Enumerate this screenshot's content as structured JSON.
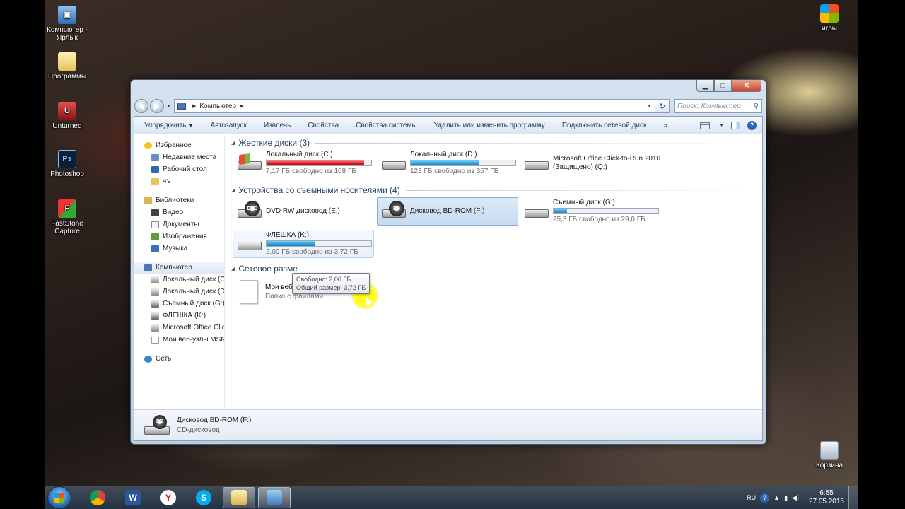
{
  "desktop": {
    "icons": [
      {
        "label": "Компьютер - Ярлык",
        "icon": "computer-shortcut-icon"
      },
      {
        "label": "Программы",
        "icon": "folder-icon"
      },
      {
        "label": "Unturned",
        "icon": "unturned-icon"
      },
      {
        "label": "Photoshop",
        "icon": "photoshop-icon"
      },
      {
        "label": "FastStone Capture",
        "icon": "faststone-icon"
      },
      {
        "label": "игры",
        "icon": "games-icon"
      },
      {
        "label": "Корзина",
        "icon": "recycle-bin-icon"
      }
    ]
  },
  "window": {
    "address": {
      "root": "Компьютер"
    },
    "search_placeholder": "Поиск: Компьютер",
    "toolbar": {
      "organize": "Упорядочить",
      "autoplay": "Автозапуск",
      "eject": "Извлечь",
      "properties": "Свойства",
      "system_properties": "Свойства системы",
      "uninstall": "Удалить или изменить программу",
      "map_drive": "Подключить сетевой диск",
      "more": "»"
    },
    "nav": {
      "favorites": "Избранное",
      "recent": "Недавние места",
      "desktop": "Рабочий стол",
      "ch": "чъ",
      "libraries": "Библиотеки",
      "video": "Видео",
      "documents": "Документы",
      "pictures": "Изображения",
      "music": "Музыка",
      "computer": "Компьютер",
      "drive_c": "Локальный диск (C:",
      "drive_d": "Локальный диск (D",
      "drive_g": "Съемный диск (G:)",
      "drive_k": "ФЛЕШКА (K:)",
      "office": "Microsoft Office Clic",
      "msn": "Мои веб-узлы MSN",
      "network": "Сеть"
    },
    "groups": {
      "hard_drives": "Жесткие диски (3)",
      "removable": "Устройства со съемными носителями (4)",
      "network_locations": "Сетевое разме"
    },
    "drives": {
      "c": {
        "name": "Локальный диск (C:)",
        "free": "7,17 ГБ свободно из 108 ГБ",
        "used_fraction": 0.934
      },
      "d": {
        "name": "Локальный диск (D:)",
        "free": "123 ГБ свободно из 357 ГБ",
        "used_fraction": 0.655
      },
      "q": {
        "name": "Microsoft Office Click-to-Run 2010",
        "sub": "(Защищено) (Q:)"
      },
      "e": {
        "name": "DVD RW дисковод (E:)",
        "disc_label": "DVD"
      },
      "f": {
        "name": "Дисковод BD-ROM (F:)",
        "disc_label": "BD"
      },
      "g": {
        "name": "Съемный диск (G:)",
        "free": "25,3 ГБ свободно из 29,0 ГБ",
        "used_fraction": 0.128
      },
      "k": {
        "name": "ФЛЕШКА (K:)",
        "free": "2,00 ГБ свободно из 3,72 ГБ",
        "used_fraction": 0.462
      }
    },
    "tooltip": {
      "free": "Свободно: 2,00 ГБ",
      "total": "Общий размер: 3,72 ГБ"
    },
    "msn_folder": {
      "name": "Мои веб-узлы MSN",
      "type": "Папка с файлами"
    },
    "details": {
      "name": "Дисковод BD-ROM (F:)",
      "type": "CD-дисковод",
      "disc_label": "BD"
    }
  },
  "taskbar": {
    "apps": [
      "chrome-icon",
      "word-icon",
      "yandex-icon",
      "skype-icon",
      "explorer-icon",
      "screenshot-icon"
    ],
    "lang": "RU",
    "help": "?",
    "time": "6:55",
    "date": "27.05.2015"
  }
}
